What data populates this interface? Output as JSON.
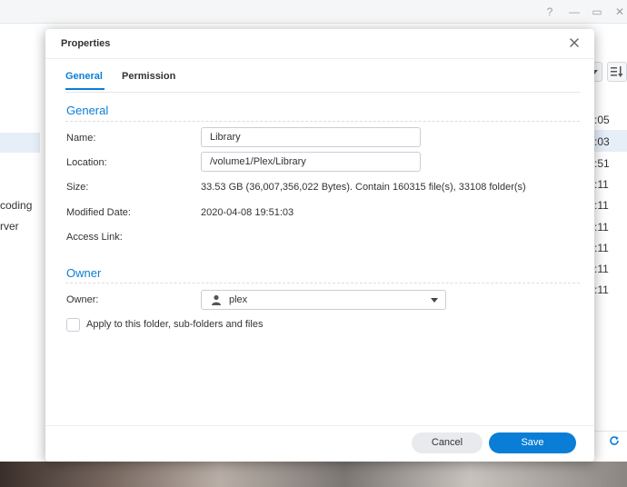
{
  "background_window": {
    "left_items": [
      {
        "label": "coding"
      },
      {
        "label": "rver"
      }
    ],
    "times": [
      ":05",
      ":03",
      ":51",
      ":11",
      ":11",
      ":11",
      ":11",
      ":11",
      ":11"
    ],
    "window_controls": [
      "?",
      "—",
      "▭",
      "✕"
    ]
  },
  "dialog": {
    "title": "Properties",
    "close_icon": "close-icon",
    "tabs": [
      {
        "label": "General",
        "active": true
      },
      {
        "label": "Permission",
        "active": false
      }
    ],
    "general": {
      "section_title": "General",
      "name_label": "Name:",
      "name_value": "Library",
      "location_label": "Location:",
      "location_value": "/volume1/Plex/Library",
      "size_label": "Size:",
      "size_value": "33.53 GB (36,007,356,022 Bytes). Contain 160315 file(s), 33108 folder(s)",
      "modified_label": "Modified Date:",
      "modified_value": "2020-04-08 19:51:03",
      "access_link_label": "Access Link:",
      "access_link_value": ""
    },
    "owner": {
      "section_title": "Owner",
      "owner_label": "Owner:",
      "owner_value": "plex",
      "apply_label": "Apply to this folder, sub-folders and files",
      "apply_checked": false
    },
    "buttons": {
      "cancel": "Cancel",
      "save": "Save"
    }
  },
  "colors": {
    "accent": "#0a7ed6",
    "text": "#333333",
    "cancel_bg": "#e8eaed"
  }
}
